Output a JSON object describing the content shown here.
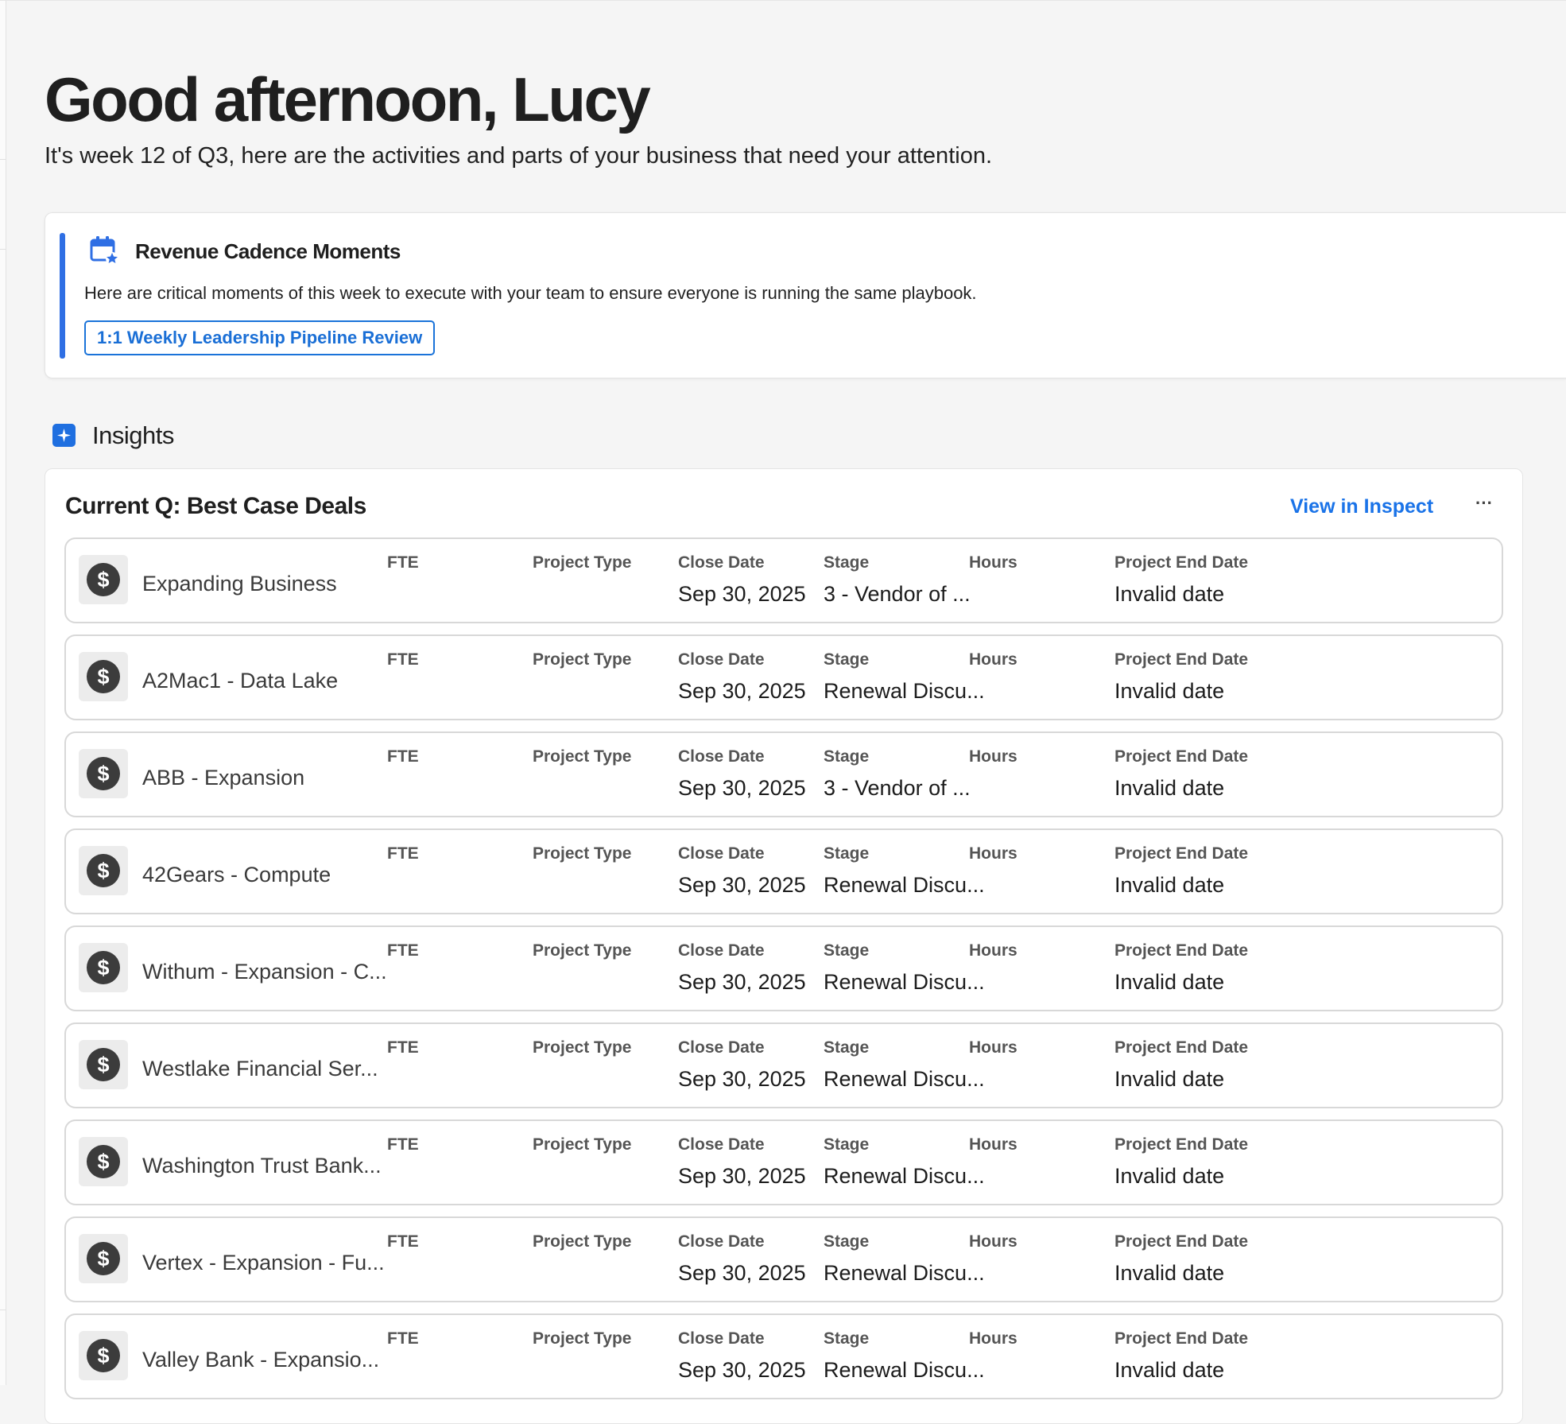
{
  "header": {
    "greeting": "Good afternoon, Lucy",
    "subtitle": "It's week 12 of Q3, here are the activities and parts of your business that need your attention."
  },
  "cadence": {
    "title": "Revenue Cadence Moments",
    "description": "Here are critical moments of this week to execute with your team to ensure everyone is running the same playbook.",
    "button_label": "1:1 Weekly Leadership Pipeline Review",
    "icon": "calendar-star-icon",
    "accent_color": "#2f6fe4"
  },
  "insights": {
    "title": "Insights",
    "icon": "sparkle-icon"
  },
  "deals": {
    "title": "Current Q: Best Case Deals",
    "view_link": "View in Inspect",
    "more_label": "···",
    "columns": {
      "fte": "FTE",
      "project_type": "Project Type",
      "close_date": "Close Date",
      "stage": "Stage",
      "hours": "Hours",
      "project_end_date": "Project End Date"
    },
    "rows": [
      {
        "name": "Expanding Business",
        "close_date": "Sep 30, 2025",
        "stage": "3 - Vendor of ...",
        "project_end_date": "Invalid date"
      },
      {
        "name": "A2Mac1 - Data Lake",
        "close_date": "Sep 30, 2025",
        "stage": "Renewal Discu...",
        "project_end_date": "Invalid date"
      },
      {
        "name": "ABB - Expansion",
        "close_date": "Sep 30, 2025",
        "stage": "3 - Vendor of ...",
        "project_end_date": "Invalid date"
      },
      {
        "name": "42Gears - Compute",
        "close_date": "Sep 30, 2025",
        "stage": "Renewal Discu...",
        "project_end_date": "Invalid date"
      },
      {
        "name": "Withum - Expansion - C...",
        "close_date": "Sep 30, 2025",
        "stage": "Renewal Discu...",
        "project_end_date": "Invalid date"
      },
      {
        "name": "Westlake Financial Ser...",
        "close_date": "Sep 30, 2025",
        "stage": "Renewal Discu...",
        "project_end_date": "Invalid date"
      },
      {
        "name": "Washington Trust Bank...",
        "close_date": "Sep 30, 2025",
        "stage": "Renewal Discu...",
        "project_end_date": "Invalid date"
      },
      {
        "name": "Vertex - Expansion - Fu...",
        "close_date": "Sep 30, 2025",
        "stage": "Renewal Discu...",
        "project_end_date": "Invalid date"
      },
      {
        "name": "Valley Bank - Expansio...",
        "close_date": "Sep 30, 2025",
        "stage": "Renewal Discu...",
        "project_end_date": "Invalid date"
      }
    ],
    "row_icon": "dollar-icon",
    "link_color": "#1a73e8"
  }
}
